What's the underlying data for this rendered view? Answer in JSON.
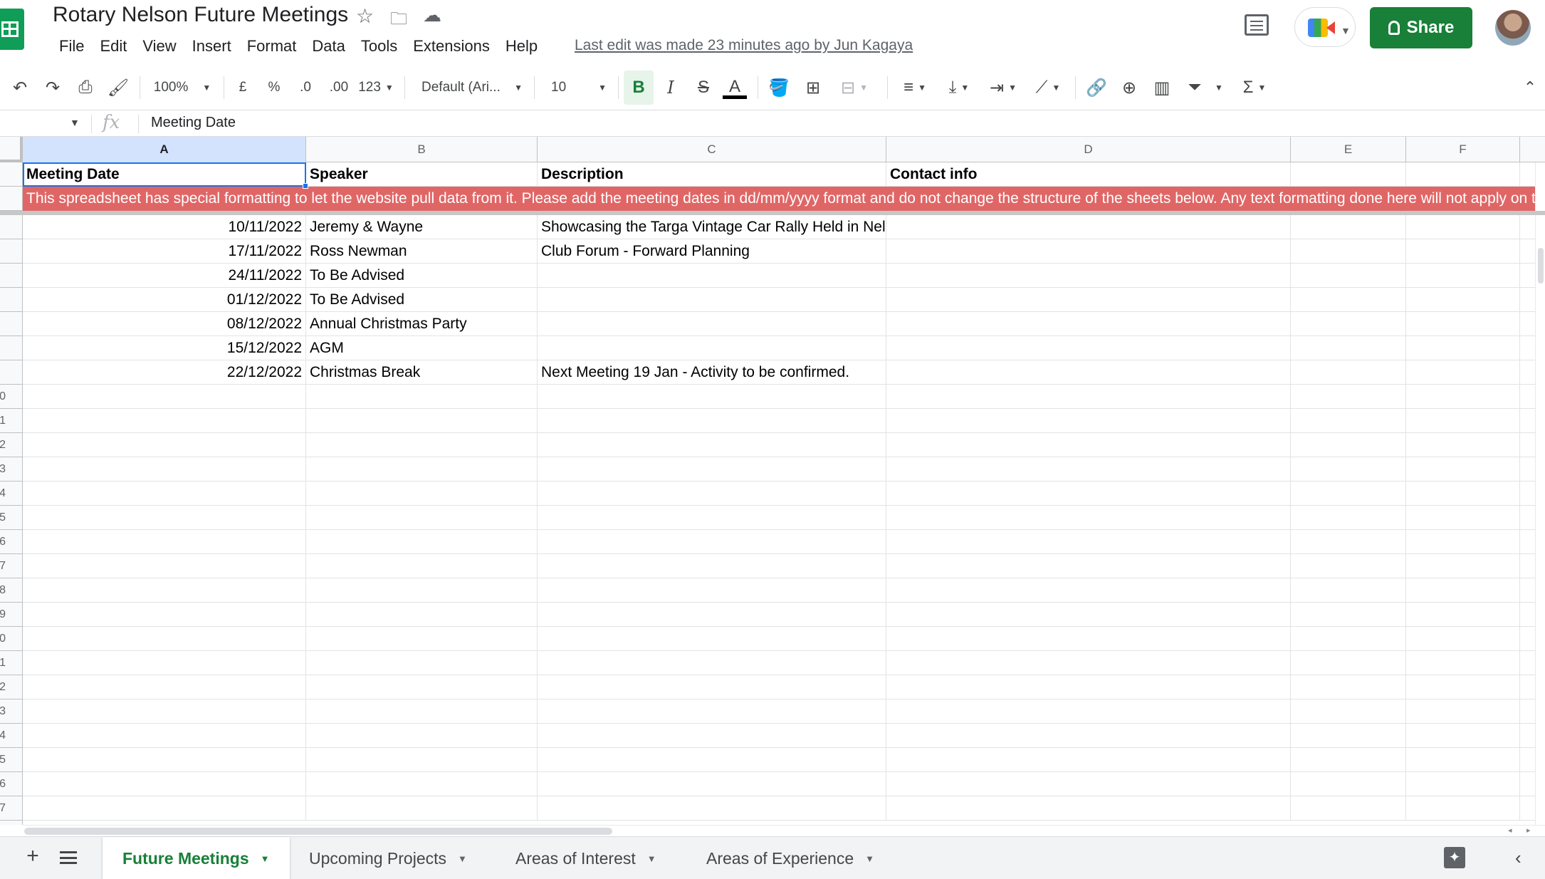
{
  "document": {
    "title": "Rotary Nelson Future Meetings",
    "last_edit": "Last edit was made 23 minutes ago by Jun Kagaya"
  },
  "menu": [
    "File",
    "Edit",
    "View",
    "Insert",
    "Format",
    "Data",
    "Tools",
    "Extensions",
    "Help"
  ],
  "share_button": {
    "label": "Share",
    "color": "#188038"
  },
  "toolbar": {
    "zoom": "100%",
    "currency": "£",
    "percent": "%",
    "decrease_decimals": ".0",
    "increase_decimals": ".00",
    "number_format": "123",
    "font": "Default (Ari...",
    "font_size": "10",
    "bold": "B",
    "italic": "I",
    "strikethrough": "S",
    "text_color": "A"
  },
  "formula_bar": {
    "fx": "fx",
    "value": "Meeting Date"
  },
  "columns": [
    "A",
    "B",
    "C",
    "D",
    "E",
    "F"
  ],
  "header_row": [
    "Meeting Date",
    "Speaker",
    "Description",
    "Contact info",
    "",
    ""
  ],
  "banner": {
    "text": "This spreadsheet has special formatting to let the website pull data from it. Please add the meeting dates in dd/mm/yyyy format and do not change the structure of the sheets below. Any text formatting done here will not apply on the website.",
    "color": "#e06666"
  },
  "rows": [
    [
      "10/11/2022",
      "Jeremy & Wayne",
      "Showcasing the Targa Vintage Car Rally Held in Nelson",
      "",
      "",
      ""
    ],
    [
      "17/11/2022",
      "Ross Newman",
      "Club Forum - Forward Planning",
      "",
      "",
      ""
    ],
    [
      "24/11/2022",
      "To Be Advised",
      "",
      "",
      "",
      ""
    ],
    [
      "01/12/2022",
      "To Be Advised",
      "",
      "",
      "",
      ""
    ],
    [
      "08/12/2022",
      "Annual Christmas Party",
      "",
      "",
      "",
      ""
    ],
    [
      "15/12/2022",
      "AGM",
      "",
      "",
      "",
      ""
    ],
    [
      "22/12/2022",
      "Christmas Break",
      "Next Meeting 19 Jan - Activity to be confirmed.",
      "",
      "",
      ""
    ]
  ],
  "row_labels_visible": [
    "0",
    "1",
    "2",
    "3",
    "4",
    "5",
    "6",
    "7",
    "8",
    "9",
    "0",
    "1",
    "2",
    "3",
    "4",
    "5",
    "6",
    "7"
  ],
  "sheets": [
    {
      "name": "Future Meetings",
      "active": true
    },
    {
      "name": "Upcoming Projects",
      "active": false
    },
    {
      "name": "Areas of Interest",
      "active": false
    },
    {
      "name": "Areas of Experience",
      "active": false
    }
  ],
  "icons": {
    "star": "star-icon",
    "move": "move-to-folder-icon",
    "saved": "cloud-saved-icon",
    "comments": "comments-icon",
    "meet": "google-meet-icon"
  }
}
